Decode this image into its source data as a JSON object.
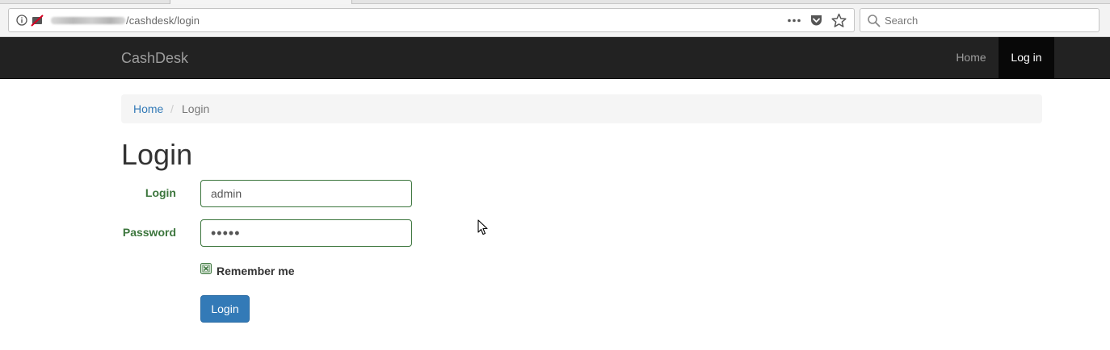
{
  "browser": {
    "url_path": "/cashdesk/login",
    "search_placeholder": "Search"
  },
  "navbar": {
    "brand": "CashDesk",
    "links": [
      "Home",
      "Log in"
    ],
    "active_link": "Log in"
  },
  "breadcrumb": {
    "home": "Home",
    "separator": "/",
    "current": "Login"
  },
  "page": {
    "title": "Login"
  },
  "form": {
    "login_label": "Login",
    "login_value": "admin",
    "password_label": "Password",
    "password_value": "admin",
    "remember_label": "Remember me",
    "remember_checked": true,
    "submit_label": "Login"
  },
  "colors": {
    "navbar_bg": "#222222",
    "success_green": "#3c763d",
    "primary_blue": "#337ab7",
    "link_blue": "#337ab7"
  },
  "icons": [
    "info-icon",
    "no-permission-icon",
    "more-icon",
    "pocket-icon",
    "star-icon",
    "search-icon",
    "checkbox-icon",
    "mouse-cursor-icon"
  ]
}
